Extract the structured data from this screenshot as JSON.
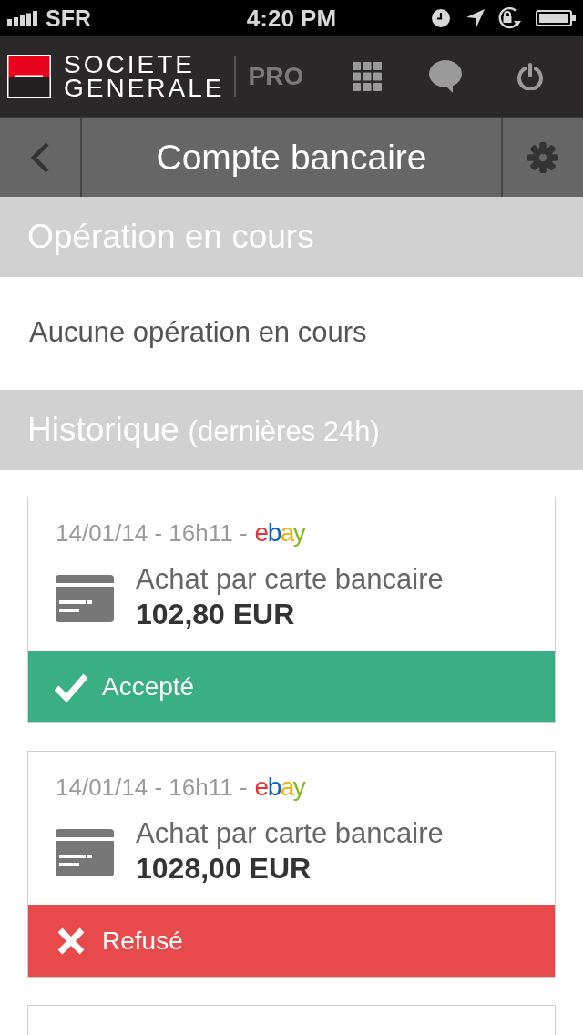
{
  "status_bar": {
    "carrier": "SFR",
    "time": "4:20 PM"
  },
  "header": {
    "brand_line_1": "SOCIETE",
    "brand_line_2": "GENERALE",
    "product": "PRO"
  },
  "nav": {
    "title": "Compte bancaire"
  },
  "pending": {
    "title": "Opération en cours",
    "message": "Aucune opération en cours"
  },
  "history": {
    "title": "Historique",
    "subtitle": "(dernières 24h)",
    "operations": [
      {
        "kind": "full",
        "date": "14/01/14 - 16h11 -",
        "merchant": "ebay",
        "label": "Achat par carte bancaire",
        "amount": "102,80 EUR",
        "accepted": true,
        "status_label": "Accepté"
      },
      {
        "kind": "full",
        "date": "14/01/14 - 16h11 -",
        "merchant": "ebay",
        "label": "Achat par carte bancaire",
        "amount": "1028,00 EUR",
        "accepted": false,
        "status_label": "Refusé"
      },
      {
        "kind": "partial"
      }
    ]
  }
}
